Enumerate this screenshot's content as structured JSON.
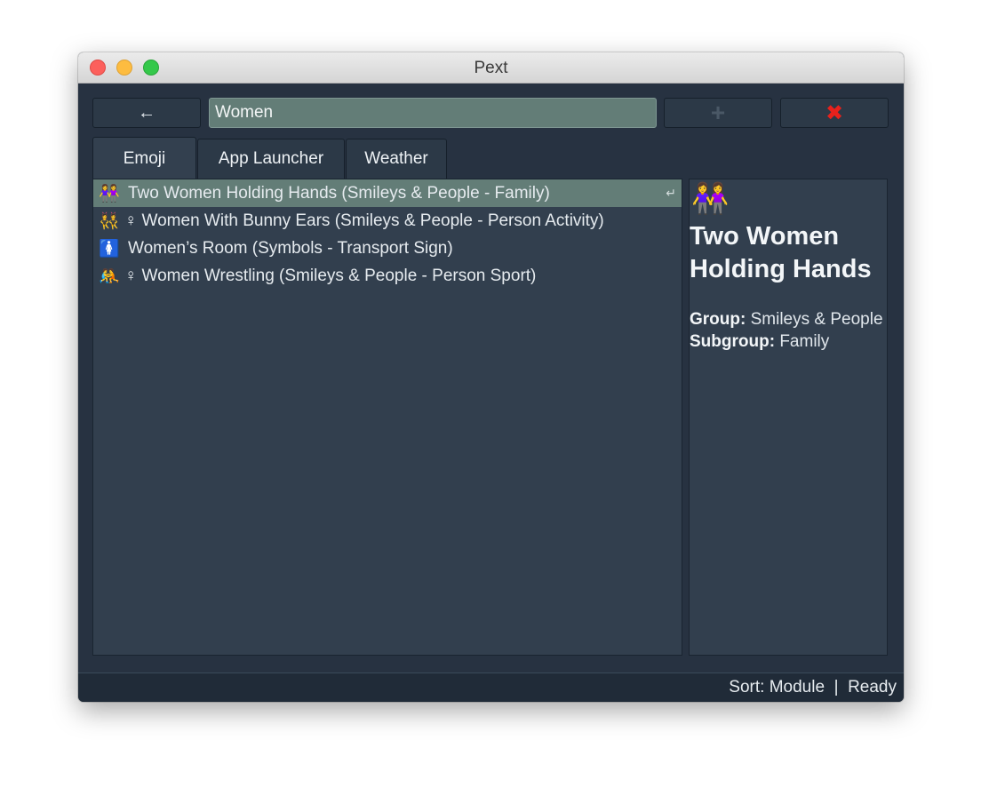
{
  "window": {
    "title": "Pext"
  },
  "toolbar": {
    "back_label": "←",
    "search_value": "Women",
    "search_placeholder": "",
    "add_label": "+",
    "close_label": "✖"
  },
  "tabs": [
    {
      "label": "Emoji"
    },
    {
      "label": "App Launcher"
    },
    {
      "label": "Weather"
    }
  ],
  "results": [
    {
      "emoji": "👭",
      "text": "Two Women Holding Hands (Smileys & People - Family)",
      "selected": true
    },
    {
      "emoji": "👯‍♀",
      "text": "♀ Women With Bunny Ears (Smileys & People - Person Activity)",
      "selected": false
    },
    {
      "emoji": "🚺",
      "text": "Women’s Room (Symbols - Transport Sign)",
      "selected": false
    },
    {
      "emoji": "🤼",
      "text": "♀ Women Wrestling (Smileys & People - Person Sport)",
      "selected": false
    }
  ],
  "enter_hint": "↵",
  "detail": {
    "emoji": "👭",
    "title": "Two Women Holding Hands",
    "group_label": "Group:",
    "group_value": "Smileys & People",
    "subgroup_label": "Subgroup:",
    "subgroup_value": "Family"
  },
  "status": {
    "text": "Sort: Module  |  Ready"
  },
  "colors": {
    "selection": "#637d77",
    "close_red": "#e8211c",
    "background": "#273241"
  }
}
